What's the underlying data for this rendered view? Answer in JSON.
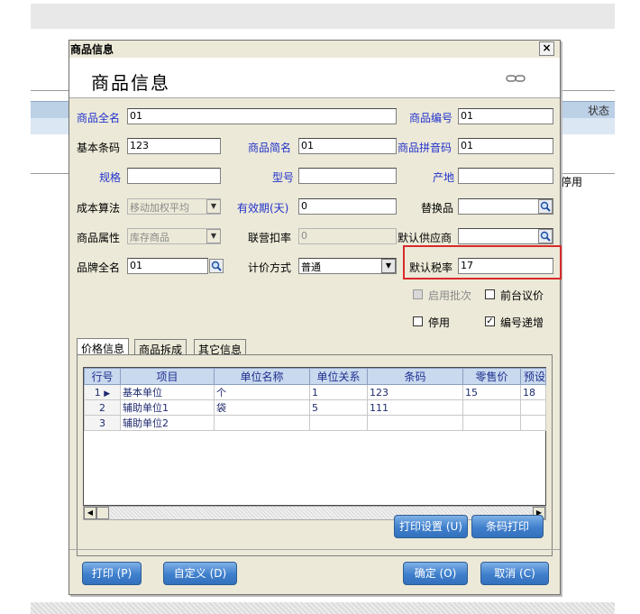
{
  "background": {
    "right_header": "状态",
    "right_row_status": "停用"
  },
  "dialog": {
    "window_title": "商品信息",
    "page_title": "商品信息",
    "close_symbol": "×"
  },
  "form": {
    "full_name_label": "商品全名",
    "full_name_value": "01",
    "code_label": "商品编号",
    "code_value": "01",
    "barcode_label": "基本条码",
    "barcode_value": "123",
    "short_name_label": "商品简名",
    "short_name_value": "01",
    "pinyin_label": "商品拼音码",
    "pinyin_value": "01",
    "spec_label": "规格",
    "spec_value": "",
    "model_label": "型号",
    "model_value": "",
    "origin_label": "产地",
    "origin_value": "",
    "cost_method_label": "成本算法",
    "cost_method_value": "移动加权平均",
    "expiry_label": "有效期(天)",
    "expiry_value": "0",
    "substitute_label": "替换品",
    "substitute_value": "",
    "attribute_label": "商品属性",
    "attribute_value": "库存商品",
    "joint_rate_label": "联营扣率",
    "joint_rate_value": "0",
    "supplier_label": "默认供应商",
    "supplier_value": "",
    "brand_label": "品牌全名",
    "brand_value": "01",
    "pricing_label": "计价方式",
    "pricing_value": "普通",
    "tax_label": "默认税率",
    "tax_value": "17",
    "batch_label": "启用批次",
    "counter_price_label": "前台议价",
    "disabled_label": "停用",
    "auto_increment_label": "编号递增",
    "checked_mark": "✓"
  },
  "tabs": [
    "价格信息",
    "商品拆成",
    "其它信息"
  ],
  "grid": {
    "columns": [
      "行号",
      "项目",
      "单位名称",
      "单位关系",
      "条码",
      "零售价",
      "预设"
    ],
    "rows": [
      [
        "1",
        "基本单位",
        "个",
        "1",
        "123",
        "15",
        "18"
      ],
      [
        "2",
        "辅助单位1",
        "袋",
        "5",
        "111",
        "",
        ""
      ],
      [
        "3",
        "辅助单位2",
        "",
        "",
        "",
        "",
        ""
      ]
    ],
    "current_row_marker": "▶"
  },
  "buttons": {
    "print_settings": "打印设置 (U)",
    "barcode_print": "条码打印",
    "print": "打印 (P)",
    "custom": "自定义 (D)",
    "ok": "确定 (O)",
    "cancel": "取消 (C)"
  }
}
